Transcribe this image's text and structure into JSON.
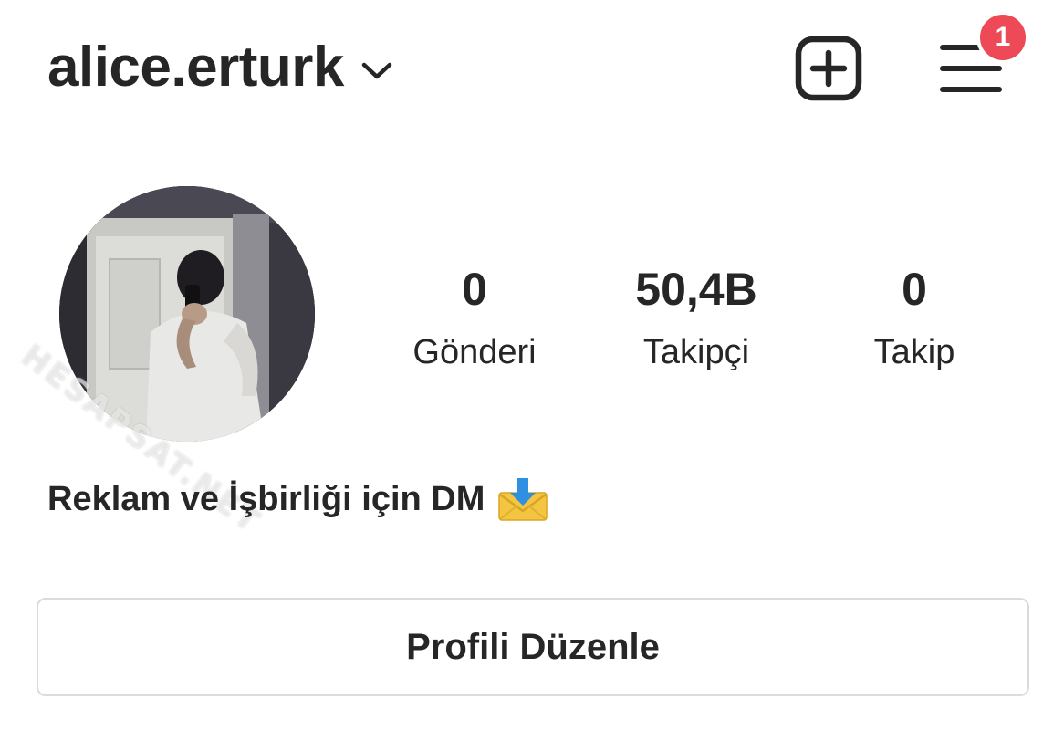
{
  "header": {
    "username": "alice.erturk",
    "notification_count": "1",
    "icons": {
      "account_switcher": "chevron-down-icon",
      "new_post": "plus-square-icon",
      "menu": "hamburger-menu-icon"
    }
  },
  "profile": {
    "avatar": "profile-photo",
    "watermark": "HESAPSAT.NET",
    "stats": [
      {
        "count": "0",
        "label": "Gönderi"
      },
      {
        "count": "50,4B",
        "label": "Takipçi"
      },
      {
        "count": "0",
        "label": "Takip"
      }
    ],
    "bio": "Reklam ve İşbirliği için DM",
    "bio_emoji": "envelope-with-arrow-icon"
  },
  "actions": {
    "edit_profile_label": "Profili Düzenle"
  },
  "colors": {
    "text": "#262626",
    "badge": "#ed4956",
    "border": "#dbdbdb",
    "background": "#ffffff"
  }
}
